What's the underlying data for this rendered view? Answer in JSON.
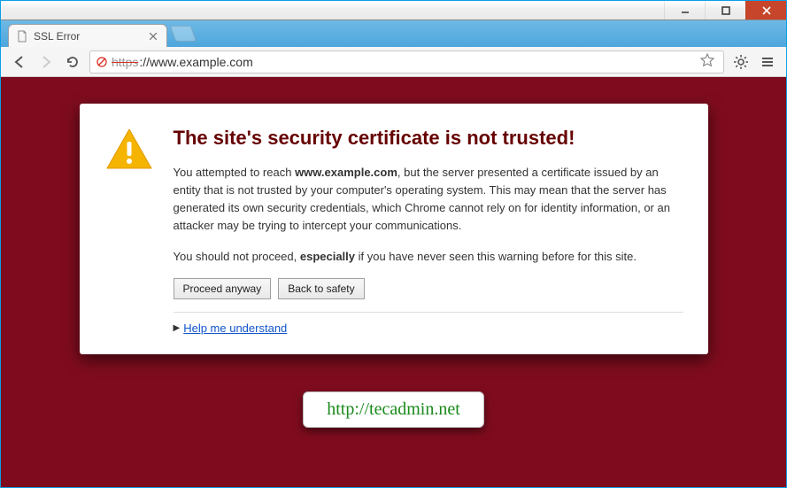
{
  "window": {
    "tab_title": "SSL Error"
  },
  "toolbar": {
    "url_https": "https",
    "url_rest": "://www.example.com"
  },
  "warning": {
    "heading": "The site's security certificate is not trusted!",
    "p1_a": "You attempted to reach ",
    "p1_bold": "www.example.com",
    "p1_b": ", but the server presented a certificate issued by an entity that is not trusted by your computer's operating system. This may mean that the server has generated its own security credentials, which Chrome cannot rely on for identity information, or an attacker may be trying to intercept your communications.",
    "p2_a": "You should not proceed, ",
    "p2_bold": "especially",
    "p2_b": " if you have never seen this warning before for this site.",
    "proceed_label": "Proceed anyway",
    "back_label": "Back to safety",
    "help_label": "Help me understand"
  },
  "watermark": {
    "text": "http://tecadmin.net"
  }
}
